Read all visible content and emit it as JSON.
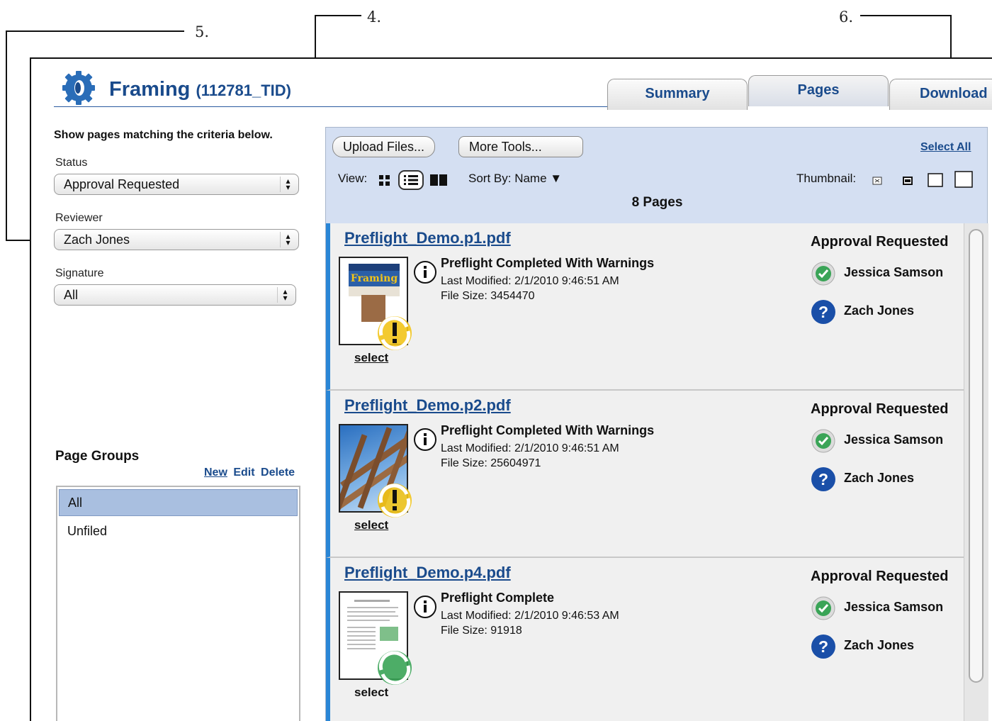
{
  "callouts": {
    "c4": "4.",
    "c5": "5.",
    "c6": "6."
  },
  "header": {
    "title": "Framing",
    "job_id": "(112781_TID)"
  },
  "tabs": [
    {
      "label": "Summary"
    },
    {
      "label": "Pages"
    },
    {
      "label": "Download"
    }
  ],
  "filters": {
    "heading": "Show pages matching the criteria below.",
    "status": {
      "label": "Status",
      "value": "Approval Requested"
    },
    "reviewer": {
      "label": "Reviewer",
      "value": "Zach Jones"
    },
    "signature": {
      "label": "Signature",
      "value": "All"
    }
  },
  "page_groups": {
    "title": "Page Groups",
    "actions": {
      "new": "New",
      "edit": "Edit",
      "delete": "Delete"
    },
    "items": [
      "All",
      "Unfiled"
    ],
    "selected": "All"
  },
  "toolbar": {
    "upload": "Upload Files...",
    "more_tools": "More Tools...",
    "select_all": "Select All",
    "view_label": "View:",
    "sort_label": "Sort By:",
    "sort_value": "Name",
    "thumbnail_label": "Thumbnail:",
    "page_count": "8 Pages"
  },
  "pages": [
    {
      "filename": "Preflight_Demo.p1.pdf",
      "preflight_status": "Preflight Completed With Warnings",
      "last_modified": "Last Modified: 2/1/2010 9:46:51 AM",
      "file_size": "File Size: 3454470",
      "select_label": "select",
      "approval": "Approval Requested",
      "reviewers": [
        "Jessica Samson",
        "Zach Jones"
      ],
      "thumb_text": "Framing"
    },
    {
      "filename": "Preflight_Demo.p2.pdf",
      "preflight_status": "Preflight Completed With Warnings",
      "last_modified": "Last Modified: 2/1/2010 9:46:51 AM",
      "file_size": "File Size: 25604971",
      "select_label": "select",
      "approval": "Approval Requested",
      "reviewers": [
        "Jessica Samson",
        "Zach Jones"
      ]
    },
    {
      "filename": "Preflight_Demo.p4.pdf",
      "preflight_status": "Preflight Complete",
      "last_modified": "Last Modified: 2/1/2010 9:46:53 AM",
      "file_size": "File Size: 91918",
      "select_label": "select",
      "approval": "Approval Requested",
      "reviewers": [
        "Jessica Samson",
        "Zach Jones"
      ]
    }
  ],
  "colors": {
    "brand": "#1a4b8c",
    "panel": "#d4dff2",
    "accent_bar": "#2a86d6",
    "warning": "#f2c419",
    "ok": "#3aa457"
  },
  "icons": {
    "logo": "gear-logo-icon",
    "info": "info-icon",
    "approved": "check-icon",
    "pending": "question-icon"
  }
}
